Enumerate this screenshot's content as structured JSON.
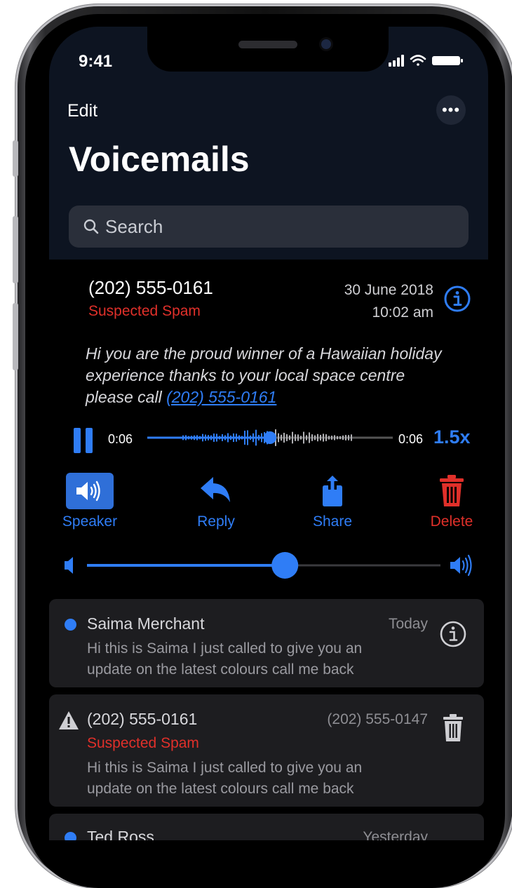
{
  "status_bar": {
    "time": "9:41"
  },
  "nav": {
    "edit_label": "Edit",
    "more_label": "•••"
  },
  "title": "Voicemails",
  "search": {
    "placeholder": "Search"
  },
  "selected_voicemail": {
    "caller": "(202) 555-0161",
    "tag": "Suspected Spam",
    "date": "30 June 2018",
    "time": "10:02 am",
    "transcript_text": "Hi you are the proud winner of a Hawaiian holiday experience thanks to your local space centre please call",
    "transcript_link": "(202) 555-0161",
    "player": {
      "elapsed": "0:06",
      "remaining": "0:06",
      "speed": "1.5x",
      "progress": 0.5
    },
    "actions": {
      "speaker": "Speaker",
      "reply": "Reply",
      "share": "Share",
      "delete": "Delete"
    },
    "volume": 0.56
  },
  "list": [
    {
      "name": "Saima Merchant",
      "when": "Today",
      "unread": true,
      "preview_line1": "Hi this is Saima I just called to give you an",
      "preview_line2": "update on the latest colours call me back"
    },
    {
      "name": "(202) 555-0161",
      "when": "(202) 555-0147",
      "tag": "Suspected Spam",
      "warning": true,
      "preview_line1": "Hi this is Saima I just called to give you an",
      "preview_line2": "update on the latest colours call me back"
    },
    {
      "name": "Ted Ross",
      "when": "Yesterday",
      "unread": true
    }
  ],
  "colors": {
    "accent": "#2f7df6",
    "danger": "#e0302a",
    "header_bg": "#0d1421"
  }
}
